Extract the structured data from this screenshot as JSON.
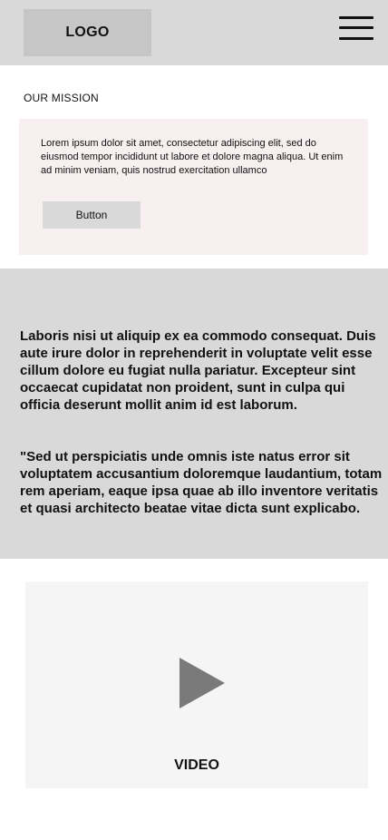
{
  "header": {
    "logo_text": "LOGO",
    "menu_icon": "hamburger-menu-icon"
  },
  "mission": {
    "title": "OUR MISSION",
    "text": "Lorem ipsum dolor sit amet, consectetur adipiscing elit, sed do eiusmod tempor incididunt ut labore et dolore magna aliqua. Ut enim ad minim veniam, quis nostrud exercitation ullamco",
    "button_label": "Button"
  },
  "band": {
    "paragraph_1": "Laboris nisi ut aliquip ex ea commodo consequat. Duis aute irure dolor in reprehenderit in voluptate velit esse cillum dolore eu fugiat nulla pariatur. Excepteur sint occaecat cupidatat non proident, sunt in culpa qui officia deserunt mollit anim id est laborum.",
    "paragraph_2": "\"Sed ut perspiciatis unde omnis iste natus error sit voluptatem accusantium doloremque laudantium, totam rem aperiam, eaque ipsa quae ab illo inventore veritatis et quasi architecto beatae vitae dicta sunt explicabo."
  },
  "video": {
    "label": "VIDEO",
    "icon": "play-icon"
  },
  "colors": {
    "header_bg": "#d9d9d9",
    "logo_bg": "#c6c6c6",
    "mission_card_bg": "#f8f0f0",
    "band_bg": "#d9d9d9",
    "video_bg": "#f5f5f5",
    "play_icon": "#7a7a7a"
  }
}
